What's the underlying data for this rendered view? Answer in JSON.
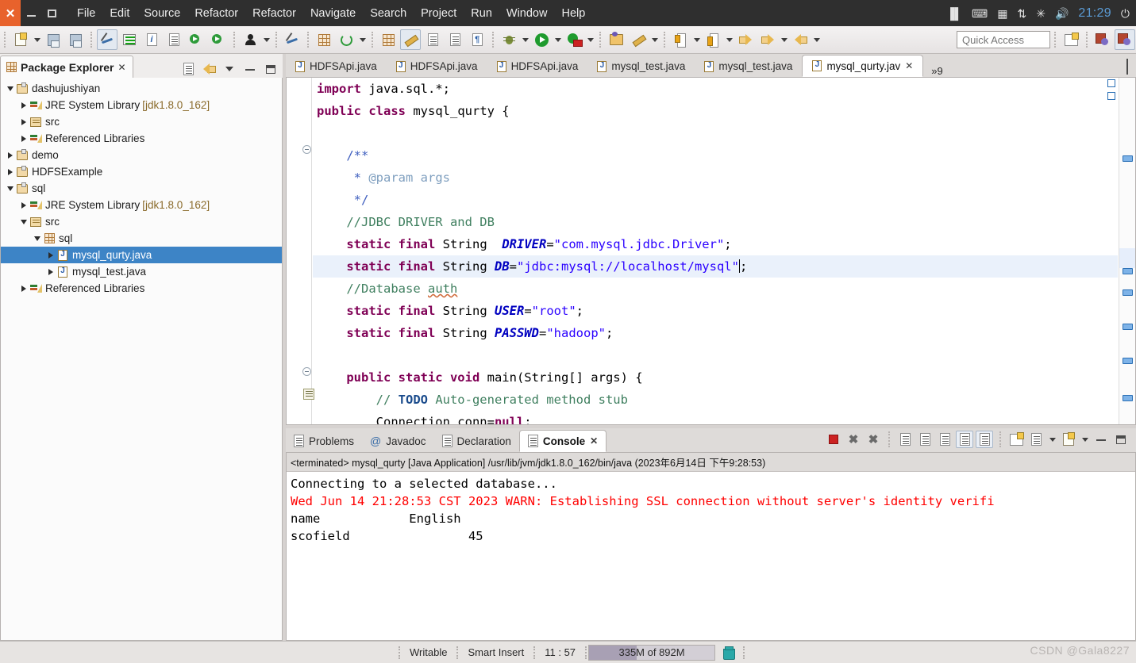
{
  "titlebar": {
    "window_controls": [
      "close",
      "minimize",
      "maximize"
    ],
    "menus": [
      "File",
      "Edit",
      "Source",
      "Refactor",
      "Refactor",
      "Navigate",
      "Search",
      "Project",
      "Run",
      "Window",
      "Help"
    ],
    "tray": {
      "icons": [
        "input-method-icon",
        "keyboard-icon",
        "calendar-icon",
        "network-icon",
        "bluetooth-icon",
        "volume-icon"
      ],
      "clock": "21:29",
      "power": "power-icon"
    }
  },
  "toolbar": {
    "quick_access_placeholder": "Quick Access",
    "items": [
      {
        "name": "new-wizard-button",
        "icon": "new-document-icon"
      },
      {
        "name": "new-wizard-dropdown",
        "icon": "chevron-down-icon"
      },
      {
        "name": "save-button",
        "icon": "save-icon"
      },
      {
        "name": "save-all-button",
        "icon": "save-all-icon"
      },
      {
        "name": "toggle-link-button",
        "icon": "link-icon"
      },
      {
        "name": "outline-button",
        "icon": "green-bars-icon"
      },
      {
        "name": "info-button",
        "icon": "italic-i-icon"
      },
      {
        "name": "properties-button",
        "icon": "lines-document-icon"
      },
      {
        "name": "run-java-button",
        "icon": "run-java-icon"
      },
      {
        "name": "run-ee-button",
        "icon": "run-ee-icon"
      },
      {
        "name": "user-button",
        "icon": "person-icon"
      },
      {
        "name": "user-dropdown",
        "icon": "chevron-down-icon"
      },
      {
        "name": "skip-breakpoints-button",
        "icon": "strike-icon"
      },
      {
        "name": "new-package-button",
        "icon": "package-grid-icon"
      },
      {
        "name": "refresh-button",
        "icon": "refresh-icon"
      },
      {
        "name": "refresh-dropdown",
        "icon": "chevron-down-icon"
      },
      {
        "name": "search-button",
        "icon": "search-marker-icon"
      },
      {
        "name": "highlight-button",
        "icon": "highlighter-icon"
      },
      {
        "name": "export-button",
        "icon": "export-icon"
      },
      {
        "name": "table-button",
        "icon": "table-icon"
      },
      {
        "name": "paragraph-button",
        "icon": "pilcrow-icon"
      },
      {
        "name": "debug-button",
        "icon": "bug-icon"
      },
      {
        "name": "debug-dropdown",
        "icon": "chevron-down-icon"
      },
      {
        "name": "run-button",
        "icon": "play-icon"
      },
      {
        "name": "run-dropdown",
        "icon": "chevron-down-icon"
      },
      {
        "name": "run-coverage-button",
        "icon": "coverage-icon"
      },
      {
        "name": "run-coverage-dropdown",
        "icon": "chevron-down-icon"
      },
      {
        "name": "open-type-button",
        "icon": "open-folder-icon"
      },
      {
        "name": "annotate-button",
        "icon": "pencil-icon"
      },
      {
        "name": "annotate-dropdown",
        "icon": "chevron-down-icon"
      },
      {
        "name": "check-in-button",
        "icon": "down-arrow-doc-icon"
      },
      {
        "name": "check-in-dropdown",
        "icon": "chevron-down-icon"
      },
      {
        "name": "check-out-button",
        "icon": "up-arrow-doc-icon"
      },
      {
        "name": "check-out-dropdown",
        "icon": "chevron-down-icon"
      },
      {
        "name": "previous-annotation-button",
        "icon": "back-arrow-star-icon"
      },
      {
        "name": "back-button",
        "icon": "back-arrow-icon"
      },
      {
        "name": "back-dropdown",
        "icon": "chevron-down-icon"
      },
      {
        "name": "forward-button",
        "icon": "forward-arrow-icon"
      },
      {
        "name": "forward-dropdown",
        "icon": "chevron-down-icon"
      }
    ],
    "perspective": [
      {
        "name": "open-perspective-button",
        "icon": "open-perspective-icon"
      },
      {
        "name": "perspective-java-ee",
        "icon": "java-ee-perspective-icon"
      },
      {
        "name": "perspective-java",
        "icon": "java-perspective-icon"
      }
    ]
  },
  "explorer": {
    "tab_title": "Package Explorer",
    "tab_close": "✕",
    "view_tools": [
      {
        "name": "collapse-all-button",
        "icon": "collapse-all-icon"
      },
      {
        "name": "link-with-editor-button",
        "icon": "link-editor-icon"
      },
      {
        "name": "view-menu-button",
        "icon": "chevron-down-icon"
      },
      {
        "name": "minimize-view-button",
        "icon": "minimize-icon"
      },
      {
        "name": "maximize-view-button",
        "icon": "maximize-icon"
      }
    ],
    "tree": [
      {
        "label": "dashujushiyan",
        "suffix": "",
        "indent": 0,
        "twisty": "open",
        "icon": "project-icon",
        "selected": false
      },
      {
        "label": "JRE System Library",
        "suffix": "[jdk1.8.0_162]",
        "indent": 1,
        "twisty": "closed",
        "icon": "library-icon",
        "selected": false
      },
      {
        "label": "src",
        "suffix": "",
        "indent": 1,
        "twisty": "closed",
        "icon": "source-folder-icon",
        "selected": false
      },
      {
        "label": "Referenced Libraries",
        "suffix": "",
        "indent": 1,
        "twisty": "closed",
        "icon": "library-icon",
        "selected": false
      },
      {
        "label": "demo",
        "suffix": "",
        "indent": 0,
        "twisty": "closed",
        "icon": "project-icon",
        "selected": false
      },
      {
        "label": "HDFSExample",
        "suffix": "",
        "indent": 0,
        "twisty": "closed",
        "icon": "project-icon",
        "selected": false
      },
      {
        "label": "sql",
        "suffix": "",
        "indent": 0,
        "twisty": "open",
        "icon": "project-icon",
        "selected": false
      },
      {
        "label": "JRE System Library",
        "suffix": "[jdk1.8.0_162]",
        "indent": 1,
        "twisty": "closed",
        "icon": "library-icon",
        "selected": false
      },
      {
        "label": "src",
        "suffix": "",
        "indent": 1,
        "twisty": "open",
        "icon": "source-folder-icon",
        "selected": false
      },
      {
        "label": "sql",
        "suffix": "",
        "indent": 2,
        "twisty": "open",
        "icon": "package-icon",
        "selected": false
      },
      {
        "label": "mysql_qurty.java",
        "suffix": "",
        "indent": 3,
        "twisty": "closed",
        "icon": "java-file-icon",
        "selected": true
      },
      {
        "label": "mysql_test.java",
        "suffix": "",
        "indent": 3,
        "twisty": "closed",
        "icon": "java-file-icon",
        "selected": false
      },
      {
        "label": "Referenced Libraries",
        "suffix": "",
        "indent": 1,
        "twisty": "closed",
        "icon": "library-icon",
        "selected": false
      }
    ]
  },
  "editor": {
    "tabs": [
      {
        "label": "HDFSApi.java",
        "active": false
      },
      {
        "label": "HDFSApi.java",
        "active": false
      },
      {
        "label": "HDFSApi.java",
        "active": false
      },
      {
        "label": "mysql_test.java",
        "active": false
      },
      {
        "label": "mysql_test.java",
        "active": false
      },
      {
        "label": "mysql_qurty.jav",
        "active": true
      }
    ],
    "active_tab_close": "✕",
    "overflow_label": "»9",
    "tools": [
      {
        "name": "restore-editor-button",
        "icon": "minimize-icon"
      },
      {
        "name": "maximize-editor-button",
        "icon": "maximize-icon"
      }
    ],
    "code_lines": [
      [
        {
          "t": "import ",
          "c": "kw"
        },
        {
          "t": "java.sql.*;",
          "c": ""
        }
      ],
      [
        {
          "t": "public class ",
          "c": "kw"
        },
        {
          "t": "mysql_qurty {",
          "c": ""
        }
      ],
      [],
      [
        {
          "t": "    /**",
          "c": "jdoc"
        }
      ],
      [
        {
          "t": "     * ",
          "c": "jdoc"
        },
        {
          "t": "@param ",
          "c": "jtag"
        },
        {
          "t": "args",
          "c": "jtag"
        }
      ],
      [
        {
          "t": "     */",
          "c": "jdoc"
        }
      ],
      [
        {
          "t": "    //JDBC DRIVER and DB",
          "c": "cmt"
        }
      ],
      [
        {
          "t": "    ",
          "c": ""
        },
        {
          "t": "static final ",
          "c": "kw"
        },
        {
          "t": "String  ",
          "c": ""
        },
        {
          "t": "DRIVER",
          "c": "fld"
        },
        {
          "t": "=",
          "c": ""
        },
        {
          "t": "\"com.mysql.jdbc.Driver\"",
          "c": "str"
        },
        {
          "t": ";",
          "c": ""
        }
      ],
      [
        {
          "t": "    ",
          "c": ""
        },
        {
          "t": "static final ",
          "c": "kw"
        },
        {
          "t": "String ",
          "c": ""
        },
        {
          "t": "DB",
          "c": "fld"
        },
        {
          "t": "=",
          "c": ""
        },
        {
          "t": "\"jdbc:mysql://localhost/mysql\"",
          "c": "str"
        },
        {
          "t": ";",
          "c": ""
        }
      ],
      [
        {
          "t": "    //Database ",
          "c": "cmt"
        },
        {
          "t": "auth",
          "c": "cmt sq"
        }
      ],
      [
        {
          "t": "    ",
          "c": ""
        },
        {
          "t": "static final ",
          "c": "kw"
        },
        {
          "t": "String ",
          "c": ""
        },
        {
          "t": "USER",
          "c": "fld"
        },
        {
          "t": "=",
          "c": ""
        },
        {
          "t": "\"root\"",
          "c": "str"
        },
        {
          "t": ";",
          "c": ""
        }
      ],
      [
        {
          "t": "    ",
          "c": ""
        },
        {
          "t": "static final ",
          "c": "kw"
        },
        {
          "t": "String ",
          "c": ""
        },
        {
          "t": "PASSWD",
          "c": "fld"
        },
        {
          "t": "=",
          "c": ""
        },
        {
          "t": "\"hadoop\"",
          "c": "str"
        },
        {
          "t": ";",
          "c": ""
        }
      ],
      [],
      [
        {
          "t": "    ",
          "c": ""
        },
        {
          "t": "public static void ",
          "c": "kw"
        },
        {
          "t": "main(String[] args) {",
          "c": ""
        }
      ],
      [
        {
          "t": "        // ",
          "c": "cmt"
        },
        {
          "t": "TODO",
          "c": "todo"
        },
        {
          "t": " Auto-generated method stub",
          "c": "cmt"
        }
      ],
      [
        {
          "t": "        Connection conn=",
          "c": ""
        },
        {
          "t": "null",
          "c": "kw"
        },
        {
          "t": ";",
          "c": ""
        }
      ]
    ],
    "highlighted_line_index": 8,
    "cursor_line_index": 8
  },
  "console": {
    "tabs": [
      {
        "label": "Problems",
        "icon": "problems-icon",
        "active": false
      },
      {
        "label": "Javadoc",
        "icon": "javadoc-icon",
        "active": false
      },
      {
        "label": "Declaration",
        "icon": "declaration-icon",
        "active": false
      },
      {
        "label": "Console",
        "icon": "console-icon",
        "active": true
      }
    ],
    "active_tab_close": "✕",
    "tools": [
      {
        "name": "terminate-button",
        "icon": "stop-icon"
      },
      {
        "name": "remove-launch-button",
        "icon": "x-icon"
      },
      {
        "name": "remove-all-terminated-button",
        "icon": "xx-icon"
      },
      {
        "name": "clear-console-button",
        "icon": "clear-console-icon"
      },
      {
        "name": "scroll-lock-button",
        "icon": "lock-icon"
      },
      {
        "name": "word-wrap-button",
        "icon": "word-wrap-icon"
      },
      {
        "name": "show-console-on-output-button",
        "icon": "show-on-output-icon"
      },
      {
        "name": "show-console-on-error-button",
        "icon": "show-on-error-icon"
      },
      {
        "name": "pin-console-button",
        "icon": "pin-icon"
      },
      {
        "name": "display-console-button",
        "icon": "display-console-icon"
      },
      {
        "name": "display-console-dropdown",
        "icon": "chevron-down-icon"
      },
      {
        "name": "open-console-button",
        "icon": "open-console-icon"
      },
      {
        "name": "open-console-dropdown",
        "icon": "chevron-down-icon"
      },
      {
        "name": "minimize-console-button",
        "icon": "minimize-icon"
      },
      {
        "name": "restore-console-button",
        "icon": "restore-icon"
      }
    ],
    "header": "<terminated> mysql_qurty [Java Application] /usr/lib/jvm/jdk1.8.0_162/bin/java (2023年6月14日 下午9:28:53)",
    "output": [
      {
        "text": "Connecting to a selected database...",
        "level": "info"
      },
      {
        "text": "Wed Jun 14 21:28:53 CST 2023 WARN: Establishing SSL connection without server's identity verifi",
        "level": "warn"
      },
      {
        "text": "name            English",
        "level": "info"
      },
      {
        "text": "scofield                45",
        "level": "info"
      }
    ]
  },
  "status": {
    "writable": "Writable",
    "insert_mode": "Smart Insert",
    "cursor_position": "11 : 57",
    "memory": "335M of 892M",
    "memory_percent": 38,
    "trash_icon": "trash-icon"
  },
  "watermark": "CSDN @Gala8227",
  "colors": {
    "titlebar_bg": "#2f2f2f",
    "close_button": "#e8622c",
    "selection_blue": "#3d84c6",
    "keyword": "#7f0055",
    "string": "#2a00ff",
    "comment": "#3f7f5f",
    "javadoc": "#3f5fbf",
    "field": "#0000c0",
    "warn_red": "#ff0000",
    "clock_blue": "#5b9bd5"
  }
}
